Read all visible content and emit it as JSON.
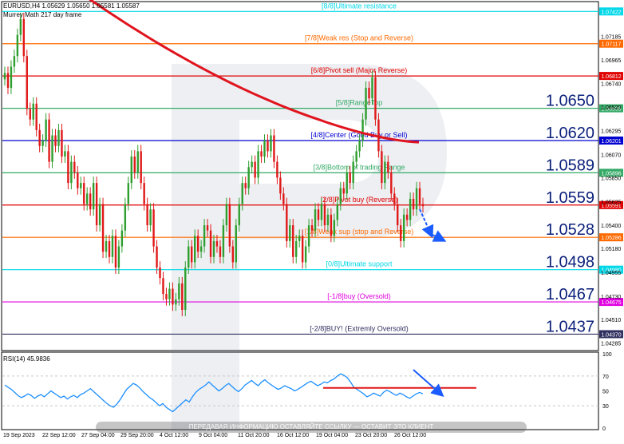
{
  "window": {
    "symbol_line": "EURUSD,H4  1.05629 1.05650 1.05581 1.05587",
    "indicator_name": "Murrey Math 217 day frame"
  },
  "colors": {
    "bull": "#2e9e2e",
    "bear": "#e01818",
    "ma": "#e0141e",
    "rsi": "#1e90ff",
    "arrow": "#1a5cff"
  },
  "chart_data": [
    {
      "type": "line",
      "name": "price",
      "x": [
        "19 Sep 2023",
        "22 Sep 12:00",
        "27 Sep 04:00",
        "29 Sep 20:00",
        "4 Oct 12:00",
        "9 Oct 04:00",
        "11 Oct 20:00",
        "16 Oct 12:00",
        "19 Oct 04:00",
        "23 Oct 20:00",
        "26 Oct 12:00"
      ],
      "ylim": [
        1.0423,
        1.075
      ],
      "y_ticks": [
        "1.07185",
        "1.06965",
        "1.06740",
        "1.06520",
        "1.06295",
        "1.06070",
        "1.05850",
        "1.05625",
        "1.05400",
        "1.05180",
        "1.04955",
        "1.04730",
        "1.04510",
        "1.04285"
      ],
      "murrey_levels": [
        {
          "label": "[8/8]Ultimate resistance",
          "value": 1.07422,
          "tag": "1.07422",
          "color": "#00d8e8"
        },
        {
          "label": "[7/8]Weak res (Stop and Reverse)",
          "value": 1.07117,
          "tag": "1.07117",
          "color": "#ff6a00"
        },
        {
          "label": "[6/8]Pivot sell (Major Reverse)",
          "value": 1.06812,
          "tag": "1.06812",
          "color": "#e00000"
        },
        {
          "label": "[5/8]RangeTop",
          "value": 1.06506,
          "tag": "1.06506",
          "color": "#33aa66"
        },
        {
          "label": "[4/8]Center (Good Buy or Sell)",
          "value": 1.06201,
          "tag": "1.06201",
          "color": "#0000d0"
        },
        {
          "label": "[3/8]Bottom of trading Range",
          "value": 1.05896,
          "tag": "1.05896",
          "color": "#33aa66"
        },
        {
          "label": "[2/8]Pivot buy (Reverse)",
          "value": 1.05591,
          "tag": "1.05591",
          "color": "#e00000"
        },
        {
          "label": "[1/8]Weak sup (stop and Reverse)",
          "value": 1.05286,
          "tag": "1.05286",
          "color": "#ff6a00"
        },
        {
          "label": "[0/8]Ultimate support",
          "value": 1.0498,
          "tag": "1.04980",
          "color": "#00d8e8"
        },
        {
          "label": "[-1/8]buy (Oversold)",
          "value": 1.04675,
          "tag": "1.04675",
          "color": "#e000e0"
        },
        {
          "label": "[-2/8]BUY! (Extremly Oversold)",
          "value": 1.0437,
          "tag": "1.04370",
          "color": "#303060"
        }
      ],
      "big_labels": [
        "1.0650",
        "1.0620",
        "1.0589",
        "1.0559",
        "1.0528",
        "1.0498",
        "1.0467",
        "1.0437"
      ],
      "candles_close": [
        1.0684,
        1.067,
        1.069,
        1.07,
        1.072,
        1.0735,
        1.07,
        1.065,
        1.064,
        1.0655,
        1.063,
        1.0615,
        1.062,
        1.064,
        1.06,
        1.0625,
        1.0615,
        1.063,
        1.0605,
        1.061,
        1.058,
        1.06,
        1.059,
        1.0575,
        1.058,
        1.056,
        1.057,
        1.0555,
        1.058,
        1.054,
        1.056,
        1.0515,
        1.0525,
        1.051,
        1.053,
        1.05,
        1.052,
        1.0535,
        1.056,
        1.058,
        1.0605,
        1.059,
        1.061,
        1.058,
        1.056,
        1.054,
        1.0555,
        1.052,
        1.05,
        1.049,
        1.0475,
        1.047,
        1.048,
        1.0465,
        1.047,
        1.0485,
        1.046,
        1.05,
        1.052,
        1.0505,
        1.053,
        1.0515,
        1.052,
        1.054,
        1.0535,
        1.051,
        1.0525,
        1.052,
        1.051,
        1.054,
        1.056,
        1.052,
        1.0505,
        1.054,
        1.056,
        1.058,
        1.0575,
        1.0595,
        1.06,
        1.0585,
        1.061,
        1.0605,
        1.062,
        1.061,
        1.0625,
        1.06,
        1.0585,
        1.057,
        1.056,
        1.0525,
        1.054,
        1.051,
        1.0525,
        1.053,
        1.0505,
        1.052,
        1.054,
        1.0535,
        1.0555,
        1.0545,
        1.056,
        1.054,
        1.055,
        1.053,
        1.0545,
        1.056,
        1.0575,
        1.057,
        1.059,
        1.058,
        1.06,
        1.061,
        1.062,
        1.064,
        1.067,
        1.066,
        1.068,
        1.064,
        1.061,
        1.058,
        1.06,
        1.059,
        1.057,
        1.056,
        1.054,
        1.0525,
        1.055,
        1.0545,
        1.0565,
        1.0555,
        1.0575,
        1.056,
        1.0558
      ]
    },
    {
      "type": "line",
      "name": "RSI(14) 45.9836",
      "ylim": [
        0,
        100
      ],
      "y_ticks": [
        "100",
        "70",
        "50",
        "30",
        "0"
      ],
      "values": [
        58,
        55,
        52,
        48,
        44,
        41,
        43,
        46,
        44,
        40,
        43,
        45,
        42,
        46,
        50,
        47,
        44,
        41,
        43,
        39,
        42,
        44,
        41,
        45,
        47,
        50,
        53,
        49,
        45,
        41,
        37,
        33,
        30,
        28,
        32,
        38,
        45,
        52,
        56,
        60,
        58,
        54,
        49,
        45,
        41,
        38,
        34,
        30,
        33,
        28,
        25,
        22,
        26,
        30,
        34,
        38,
        35,
        42,
        48,
        52,
        55,
        58,
        62,
        58,
        54,
        50,
        53,
        57,
        60,
        56,
        52,
        49,
        53,
        58,
        61,
        64,
        60,
        57,
        62,
        65,
        61,
        58,
        55,
        52,
        54,
        57,
        55,
        53,
        50,
        52,
        55,
        58,
        61,
        63,
        60,
        57,
        59,
        62,
        61,
        64,
        66,
        70,
        73,
        71,
        68,
        62,
        55,
        52,
        49,
        46,
        42,
        44,
        47,
        45,
        43,
        48,
        51,
        49,
        46,
        44,
        47,
        45,
        42,
        40,
        43,
        46,
        48,
        46
      ]
    }
  ],
  "x_axis_labels": [
    "19 Sep 2023",
    "22 Sep 12:00",
    "27 Sep 04:00",
    "29 Sep 20:00",
    "4 Oct 12:00",
    "9 Oct 04:00",
    "11 Oct 20:00",
    "16 Oct 12:00",
    "19 Oct 04:00",
    "23 Oct 20:00",
    "26 Oct 12:00"
  ],
  "watermark_text": "ПЕРЕДАВАЯ ИНФОРМАЦИЮ ОСТАВЛЯЙТЕ ССЫЛКУ — ОСТАВИТ ЭТО КЛИЕНТ"
}
